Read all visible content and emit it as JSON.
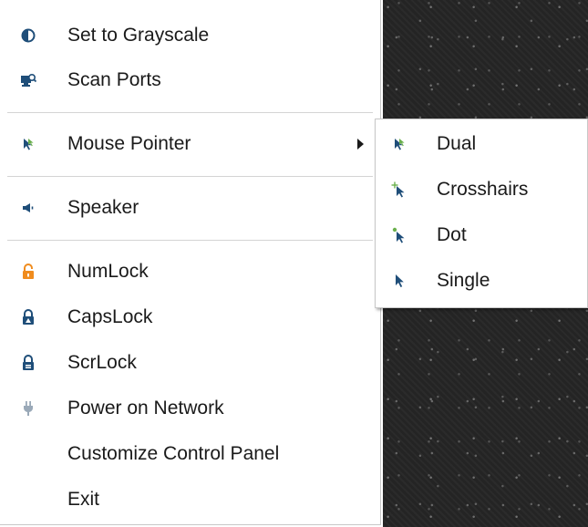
{
  "menu": {
    "items": [
      {
        "label": "Set to Grayscale",
        "icon": "contrast-icon"
      },
      {
        "label": "Scan Ports",
        "icon": "scan-ports-icon"
      },
      {
        "label": "Mouse Pointer",
        "icon": "mouse-pointer-icon",
        "has_submenu": true
      },
      {
        "label": "Speaker",
        "icon": "speaker-icon"
      },
      {
        "label": "NumLock",
        "icon": "lock-open-icon"
      },
      {
        "label": "CapsLock",
        "icon": "lock-caps-icon"
      },
      {
        "label": "ScrLock",
        "icon": "lock-scroll-icon"
      },
      {
        "label": "Power on Network",
        "icon": "power-plug-icon"
      },
      {
        "label": "Customize Control Panel"
      },
      {
        "label": "Exit"
      }
    ]
  },
  "submenu": {
    "items": [
      {
        "label": "Dual",
        "icon": "pointer-dual-icon"
      },
      {
        "label": "Crosshairs",
        "icon": "pointer-crosshairs-icon"
      },
      {
        "label": "Dot",
        "icon": "pointer-dot-icon"
      },
      {
        "label": "Single",
        "icon": "pointer-single-icon"
      }
    ]
  },
  "colors": {
    "icon_blue": "#1f4e79",
    "accent_green": "#6ab04c",
    "lock_orange": "#f08c1e",
    "plug_gray": "#9aa9b8"
  }
}
